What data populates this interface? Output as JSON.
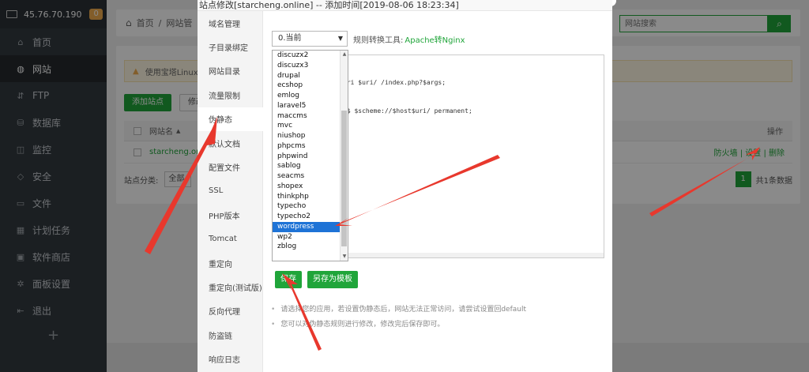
{
  "sidebar": {
    "ip": "45.76.70.190",
    "badge": "0",
    "items": [
      {
        "label": "首页",
        "icon": "home-icon",
        "glyph": "⌂"
      },
      {
        "label": "网站",
        "icon": "globe-icon",
        "glyph": "◍"
      },
      {
        "label": "FTP",
        "icon": "ftp-icon",
        "glyph": "⇵"
      },
      {
        "label": "数据库",
        "icon": "database-icon",
        "glyph": "⛁"
      },
      {
        "label": "监控",
        "icon": "monitor-icon",
        "glyph": "◫"
      },
      {
        "label": "安全",
        "icon": "shield-icon",
        "glyph": "◇"
      },
      {
        "label": "文件",
        "icon": "folder-icon",
        "glyph": "▭"
      },
      {
        "label": "计划任务",
        "icon": "calendar-icon",
        "glyph": "▦"
      },
      {
        "label": "软件商店",
        "icon": "apps-icon",
        "glyph": "▣"
      },
      {
        "label": "面板设置",
        "icon": "gear-icon",
        "glyph": "✲"
      },
      {
        "label": "退出",
        "icon": "logout-icon",
        "glyph": "⇤"
      }
    ],
    "add": "+"
  },
  "breadcrumb": {
    "home": "首页",
    "sep": "/",
    "current": "网站管"
  },
  "search": {
    "placeholder": "网站搜索"
  },
  "warning": "使用宝塔Linux面",
  "buttons": {
    "add_site": "添加站点",
    "edit_default": "修改默"
  },
  "table": {
    "col_name": "网站名",
    "col_ops": "操作",
    "row_site": "starcheng.onli",
    "ops": "防火墙 | 设置 | 删除"
  },
  "footer": {
    "category_label": "站点分类:",
    "category_value": "全部分",
    "page": "1",
    "total": "共1条数据"
  },
  "modal": {
    "title": "站点修改[starcheng.online] -- 添加时间[2019-08-06 18:23:34]",
    "tabs": [
      "域名管理",
      "子目录绑定",
      "网站目录",
      "流量限制",
      "伪静态",
      "默认文档",
      "配置文件",
      "SSL",
      "PHP版本",
      "Tomcat",
      "重定向",
      "重定向(测试版)",
      "反向代理",
      "防盗链",
      "响应日志"
    ],
    "active_tab": 4,
    "select_value": "0.当前",
    "rule_label": "规则转换工具:",
    "rule_link": "Apache转Nginx",
    "code_lines": [
      "uri $uri/ /index.php?$args;",
      "n$ $scheme://$host$uri/ permanent;"
    ],
    "dropdown_options": [
      "discuzx2",
      "discuzx3",
      "drupal",
      "ecshop",
      "emlog",
      "laravel5",
      "maccms",
      "mvc",
      "niushop",
      "phpcms",
      "phpwind",
      "sablog",
      "seacms",
      "shopex",
      "thinkphp",
      "typecho",
      "typecho2",
      "wordpress",
      "wp2",
      "zblog"
    ],
    "dropdown_selected": "wordpress",
    "save": "保存",
    "save_template": "另存为模板",
    "hints": [
      "请选择您的应用，若设置伪静态后，网站无法正常访问，请尝试设置回default",
      "您可以对伪静态规则进行修改，修改完后保存即可。"
    ]
  },
  "colors": {
    "accent": "#20a53a",
    "sidebar": "#333a40",
    "arrow": "#e8382d",
    "selected": "#1e73d6"
  }
}
